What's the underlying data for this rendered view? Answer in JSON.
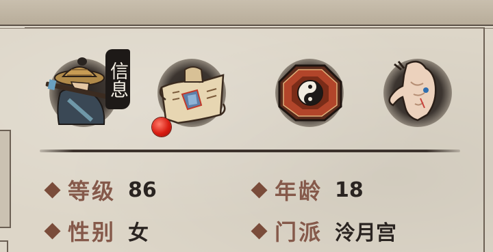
{
  "tabs": [
    {
      "id": "info",
      "label": "信息",
      "icon": "straw-hat-swordsman-icon",
      "active": true
    },
    {
      "id": "map",
      "icon": "scroll-map-icon",
      "badge": true
    },
    {
      "id": "bagua",
      "icon": "bagua-yinyang-icon"
    },
    {
      "id": "body",
      "icon": "muscle-body-icon"
    }
  ],
  "stats": {
    "level": {
      "label": "等级",
      "value": "86"
    },
    "age": {
      "label": "年龄",
      "value": "18"
    },
    "gender": {
      "label": "性别",
      "value": "女"
    },
    "sect": {
      "label": "门派",
      "value": "泠月宫"
    }
  },
  "colors": {
    "parchment": "#ddd6c8",
    "label": "#85594a",
    "value": "#2a2421",
    "badge": "#d81d12",
    "ink": "#1d1917"
  }
}
